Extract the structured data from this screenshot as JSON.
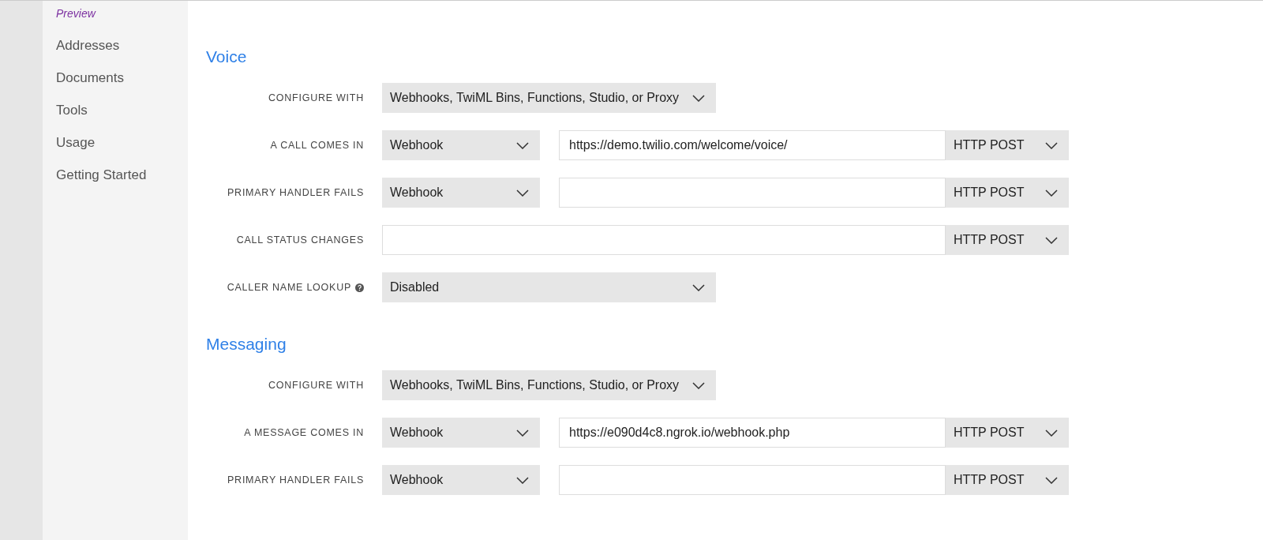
{
  "sidebar": {
    "badge": "Preview",
    "items": [
      {
        "label": "Addresses"
      },
      {
        "label": "Documents"
      },
      {
        "label": "Tools"
      },
      {
        "label": "Usage"
      },
      {
        "label": "Getting Started"
      }
    ]
  },
  "sections": [
    {
      "title": "Voice",
      "rows": [
        {
          "kind": "wide_select",
          "label": "CONFIGURE WITH",
          "help": false,
          "select": "Webhooks, TwiML Bins, Functions, Studio, or Proxy"
        },
        {
          "kind": "handler",
          "label": "A CALL COMES IN",
          "help": false,
          "select": "Webhook",
          "url": "https://demo.twilio.com/welcome/voice/",
          "method": "HTTP POST"
        },
        {
          "kind": "handler",
          "label": "PRIMARY HANDLER FAILS",
          "help": false,
          "select": "Webhook",
          "method": "HTTP POST"
        },
        {
          "kind": "url",
          "label": "CALL STATUS CHANGES",
          "help": false,
          "method": "HTTP POST"
        },
        {
          "kind": "wide_select",
          "label": "CALLER NAME LOOKUP",
          "help": true,
          "select": "Disabled"
        }
      ]
    },
    {
      "title": "Messaging",
      "rows": [
        {
          "kind": "wide_select",
          "label": "CONFIGURE WITH",
          "help": false,
          "select": "Webhooks, TwiML Bins, Functions, Studio, or Proxy"
        },
        {
          "kind": "handler",
          "label": "A MESSAGE COMES IN",
          "help": false,
          "select": "Webhook",
          "url": "https://e090d4c8.ngrok.io/webhook.php",
          "method": "HTTP POST"
        },
        {
          "kind": "handler",
          "label": "PRIMARY HANDLER FAILS",
          "help": false,
          "select": "Webhook",
          "method": "HTTP POST"
        }
      ]
    }
  ]
}
